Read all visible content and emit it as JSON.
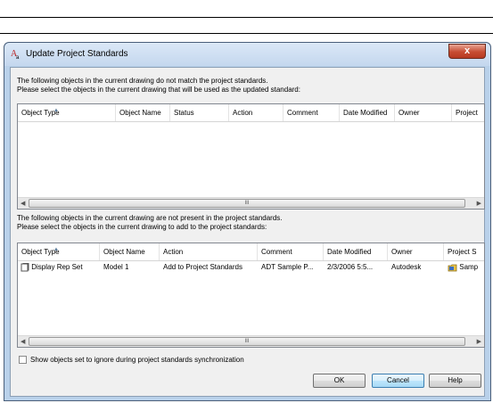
{
  "dialog": {
    "title": "Update Project Standards",
    "close_glyph": "x",
    "instructions_top_line1": "The following objects in the current drawing do not match the project standards.",
    "instructions_top_line2": "Please select the objects in the current drawing that will be used as the updated standard:",
    "instructions_bottom_line1": "The following objects in the current drawing are not present in the project standards.",
    "instructions_bottom_line2": "Please select the objects in the current drawing to add to the project standards:",
    "checkbox_label": "Show objects set to ignore during project standards synchronization",
    "checkbox_checked": false,
    "buttons": {
      "ok": "OK",
      "cancel": "Cancel",
      "help": "Help"
    },
    "scrollbar_grip": "III"
  },
  "top_list": {
    "columns": [
      "Object Type",
      "Object Name",
      "Status",
      "Action",
      "Comment",
      "Date Modified",
      "Owner",
      "Project"
    ],
    "rows": []
  },
  "bottom_list": {
    "columns": [
      "Object Type",
      "Object Name",
      "Action",
      "Comment",
      "Date Modified",
      "Owner",
      "Project S"
    ],
    "rows": [
      {
        "object_type": "Display Rep Set",
        "object_name": "Model 1",
        "action": "Add to Project Standards",
        "comment": "ADT Sample P...",
        "date_modified": "2/3/2006 5:5...",
        "owner": "Autodesk",
        "project": "Samp"
      }
    ]
  },
  "icons": {
    "app": "autocad-app-icon",
    "row_type": "display-rep-set-icon",
    "row_project": "project-folder-icon"
  },
  "colors": {
    "accent": "#3c7fb1",
    "frame": "#b9d1ea",
    "close": "#c74c32"
  }
}
